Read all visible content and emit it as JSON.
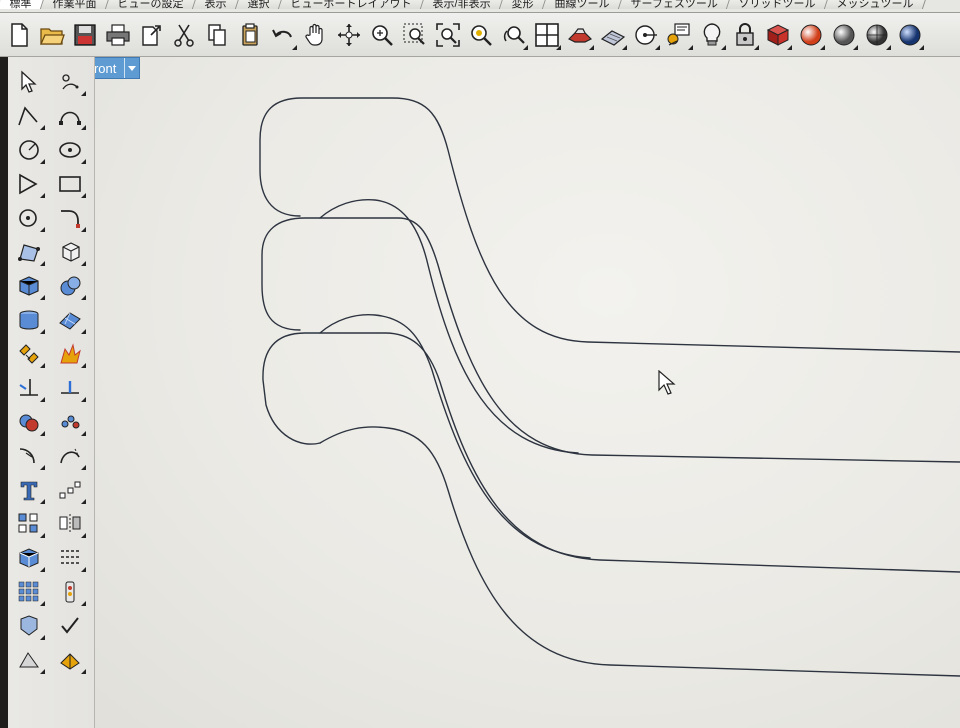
{
  "toolbar_tabs": [
    {
      "label": "標準"
    },
    {
      "label": "作業平面"
    },
    {
      "label": "ビューの設定"
    },
    {
      "label": "表示"
    },
    {
      "label": "選択"
    },
    {
      "label": "ビューポートレイアウト"
    },
    {
      "label": "表示/非表示"
    },
    {
      "label": "変形"
    },
    {
      "label": "曲線ツール"
    },
    {
      "label": "サーフェスツール"
    },
    {
      "label": "ソリッドツール"
    },
    {
      "label": "メッシュツール"
    }
  ],
  "viewport": {
    "name": "Front"
  },
  "colors": {
    "viewport_tab": "#5e9bd3",
    "curve": "#2d3440",
    "viewport_bg": "#ebeae5"
  }
}
